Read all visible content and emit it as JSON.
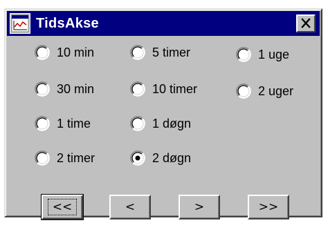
{
  "window": {
    "title": "TidsAkse",
    "icon": "chart-app-icon",
    "close_icon": "close-x-icon"
  },
  "options": [
    {
      "label": "10 min",
      "selected": false
    },
    {
      "label": "30 min",
      "selected": false
    },
    {
      "label": "1 time",
      "selected": false
    },
    {
      "label": "2 timer",
      "selected": false
    },
    {
      "label": "5 timer",
      "selected": false
    },
    {
      "label": "10 timer",
      "selected": false
    },
    {
      "label": "1 døgn",
      "selected": false
    },
    {
      "label": "2 døgn",
      "selected": true
    },
    {
      "label": "1 uge",
      "selected": false
    },
    {
      "label": "2 uger",
      "selected": false
    }
  ],
  "buttons": {
    "first": "<<",
    "prev": "<",
    "next": ">",
    "last": ">>"
  }
}
